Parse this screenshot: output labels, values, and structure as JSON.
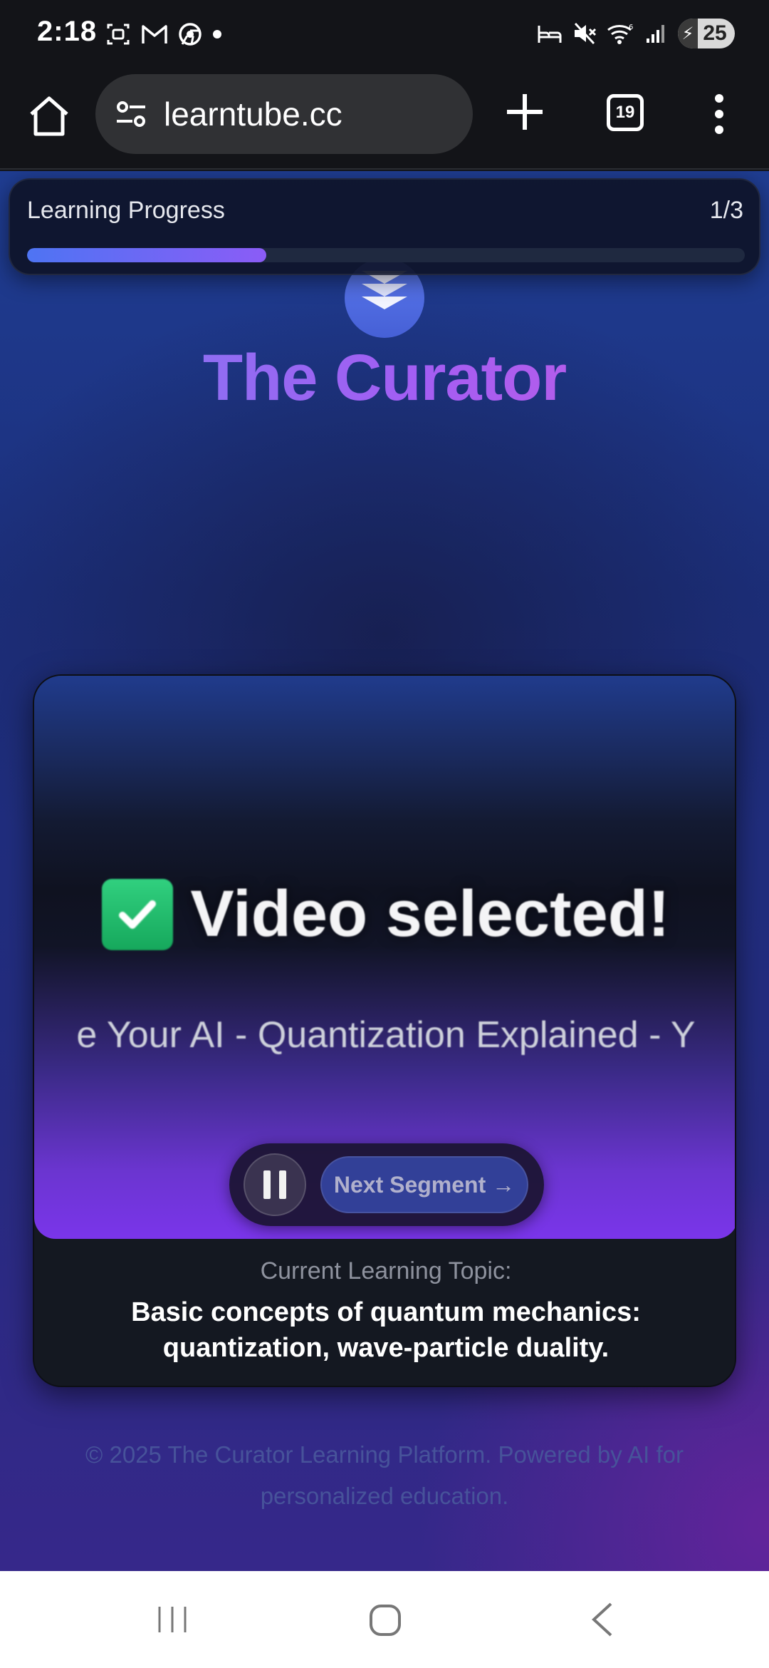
{
  "status_bar": {
    "time": "2:18",
    "battery": "25",
    "left_icons": [
      "screenshot-icon",
      "gmail-icon",
      "chrome-icon",
      "dot-icon"
    ],
    "right_icons": [
      "sleep-icon",
      "mute-icon",
      "wifi-icon",
      "signal-icon",
      "battery-icon"
    ]
  },
  "browser": {
    "url": "learntube.cc",
    "tab_count": "19"
  },
  "progress": {
    "label": "Learning Progress",
    "count": "1/3",
    "fraction": 0.333
  },
  "brand": {
    "title": "The Curator"
  },
  "video": {
    "status": "Video selected!",
    "title_visible": "e Your AI - Quantization Explained - Y",
    "next_label": "Next Segment →"
  },
  "topic": {
    "label": "Current Learning Topic:",
    "text": "Basic concepts of quantum mechanics: quantization, wave-particle duality."
  },
  "footer": {
    "text": "© 2025 The Curator Learning Platform. Powered by AI for personalized education."
  },
  "colors": {
    "accent_blue": "#4e74f3",
    "accent_purple": "#8b5cf6",
    "brand_gradient_start": "#7c7cf0",
    "brand_gradient_end": "#c65de0"
  }
}
